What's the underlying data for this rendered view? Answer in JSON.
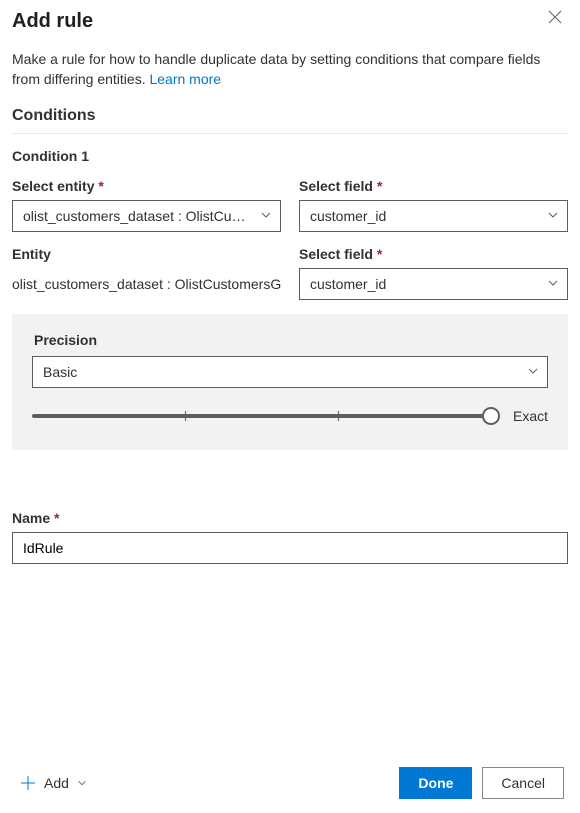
{
  "header": {
    "title": "Add rule"
  },
  "description": {
    "text_prefix": "Make a rule for how to handle duplicate data by setting conditions that compare fields from differing entities. ",
    "learn_more": "Learn more"
  },
  "conditions": {
    "heading": "Conditions",
    "condition_label": "Condition 1",
    "row1": {
      "entity_label": "Select entity",
      "entity_required_mark": "*",
      "entity_value": "olist_customers_dataset : OlistCusto...",
      "field_label": "Select field",
      "field_required_mark": "*",
      "field_value": "customer_id"
    },
    "row2": {
      "entity_label": "Entity",
      "entity_value": "olist_customers_dataset : OlistCustomersG...",
      "field_label": "Select field",
      "field_required_mark": "*",
      "field_value": "customer_id"
    },
    "precision": {
      "label": "Precision",
      "value": "Basic",
      "exact_label": "Exact"
    }
  },
  "name": {
    "label": "Name",
    "required_mark": "*",
    "value": "IdRule"
  },
  "footer": {
    "add": "Add",
    "done": "Done",
    "cancel": "Cancel"
  }
}
